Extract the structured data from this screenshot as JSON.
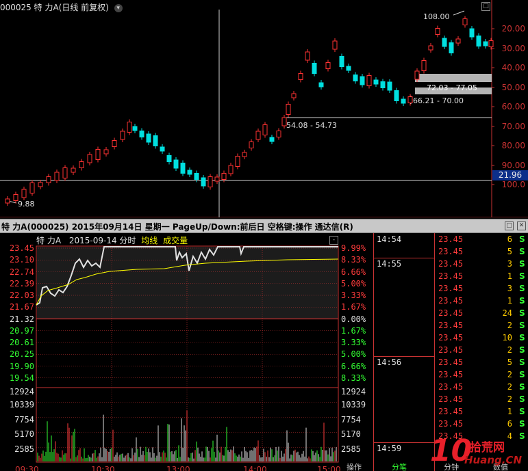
{
  "kline": {
    "title": "000025 特 力A(日线 前复权)",
    "price_axis": [
      "100.0",
      "90.00",
      "80.00",
      "70.00",
      "60.00",
      "50.00",
      "40.00",
      "30.00",
      "20.00"
    ],
    "current_price": "21.96",
    "annotations": {
      "high": "108.00",
      "low": "9.88",
      "zone1": "54.08 - 54.73",
      "zone2": "66.21 - 70.00",
      "zone3": "72.03 - 77.05"
    }
  },
  "info_bar": {
    "text": "特 力A(000025) 2015年09月14日 星期一 PageUp/Down:前后日 空格键:操作 通达信(R)"
  },
  "intraday": {
    "header_name": "特 力A",
    "header_date": "2015-09-14 分时",
    "header_avg": "均线",
    "header_vol": "成交量",
    "price_labels": [
      "23.45",
      "23.10",
      "22.74",
      "22.39",
      "22.03",
      "21.67",
      "21.32",
      "20.97",
      "20.61",
      "20.25",
      "19.90",
      "19.54"
    ],
    "pct_labels": [
      "9.99%",
      "8.33%",
      "6.66%",
      "5.00%",
      "3.33%",
      "1.67%",
      "0.00%",
      "1.67%",
      "3.33%",
      "5.00%",
      "6.66%",
      "8.33%"
    ],
    "vol_labels": [
      "12924",
      "10339",
      "7754",
      "5170",
      "2585"
    ],
    "time_labels": [
      "09:30",
      "10:30",
      "13:00",
      "14:00",
      "15:00"
    ],
    "colors": {
      "up": "#ff3c3c",
      "down": "#33ff33",
      "base": "#e0e0e0",
      "avg": "#ffff00",
      "grid": "#c83232"
    }
  },
  "ticks": {
    "rows": [
      {
        "time": "14:54",
        "price": "23.45",
        "vol": "6",
        "flag": "S"
      },
      {
        "time": "",
        "price": "23.45",
        "vol": "5",
        "flag": "S"
      },
      {
        "time": "14:55",
        "price": "23.45",
        "vol": "3",
        "flag": "S"
      },
      {
        "time": "",
        "price": "23.45",
        "vol": "1",
        "flag": "S"
      },
      {
        "time": "",
        "price": "23.45",
        "vol": "3",
        "flag": "S"
      },
      {
        "time": "",
        "price": "23.45",
        "vol": "1",
        "flag": "S"
      },
      {
        "time": "",
        "price": "23.45",
        "vol": "24",
        "flag": "S"
      },
      {
        "time": "",
        "price": "23.45",
        "vol": "2",
        "flag": "S"
      },
      {
        "time": "",
        "price": "23.45",
        "vol": "10",
        "flag": "S"
      },
      {
        "time": "",
        "price": "23.45",
        "vol": "2",
        "flag": "S"
      },
      {
        "time": "14:56",
        "price": "23.45",
        "vol": "5",
        "flag": "S"
      },
      {
        "time": "",
        "price": "23.45",
        "vol": "2",
        "flag": "S"
      },
      {
        "time": "",
        "price": "23.45",
        "vol": "2",
        "flag": "S"
      },
      {
        "time": "",
        "price": "23.45",
        "vol": "2",
        "flag": "S"
      },
      {
        "time": "",
        "price": "23.45",
        "vol": "1",
        "flag": "S"
      },
      {
        "time": "",
        "price": "23.45",
        "vol": "6",
        "flag": "S"
      },
      {
        "time": "",
        "price": "23.45",
        "vol": "4",
        "flag": "S"
      },
      {
        "time": "14:59",
        "price": "",
        "vol": "",
        "flag": ""
      }
    ]
  },
  "tabs": [
    "操作",
    "分笔",
    "分钟",
    "数值"
  ],
  "watermark": {
    "brand": "10",
    "cn": "拾荒网",
    "url": "Huang.CN"
  }
}
